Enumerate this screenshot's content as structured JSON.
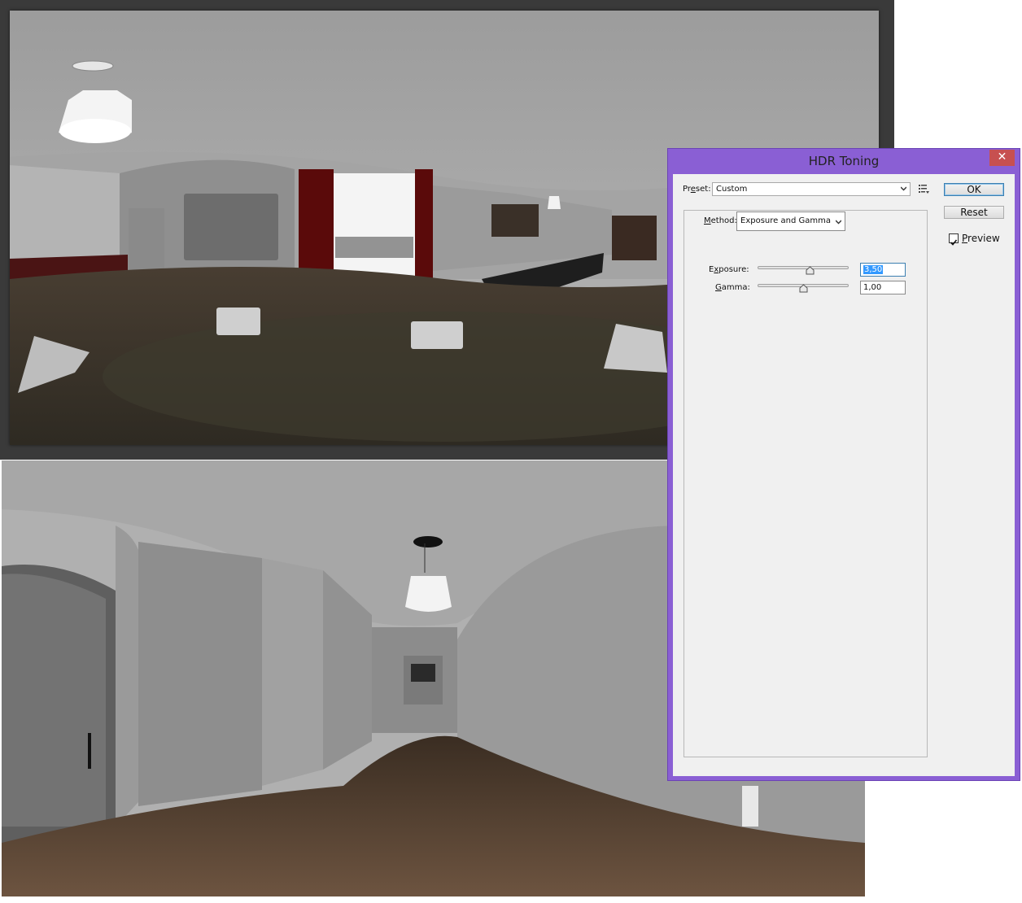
{
  "dialog": {
    "title": "HDR Toning",
    "close_glyph": "✕",
    "preset": {
      "label_pre": "Pr",
      "label_key": "e",
      "label_post": "set:",
      "value": "Custom"
    },
    "method": {
      "label_key": "M",
      "label_post": "ethod:",
      "value": "Exposure and Gamma"
    },
    "exposure": {
      "label_pre": "E",
      "label_key": "x",
      "label_post": "posure:",
      "value": "3,50",
      "slider_level": 0.58
    },
    "gamma": {
      "label_key": "G",
      "label_post": "amma:",
      "value": "1,00",
      "slider_level": 0.5
    },
    "ok_label": "OK",
    "reset_label": "Reset",
    "preview": {
      "label_key": "P",
      "label_post": "review",
      "checked": true
    }
  },
  "icons": {
    "close": "close-icon",
    "dropdown": "chevron-down-icon",
    "preset_menu": "list-menu-icon",
    "checkmark": "checkmark-icon"
  },
  "colors": {
    "dialog_frame": "#8a5fd4",
    "close_button": "#c75050",
    "canvas_bg": "#3a3a3a",
    "selection": "#3399ff"
  }
}
